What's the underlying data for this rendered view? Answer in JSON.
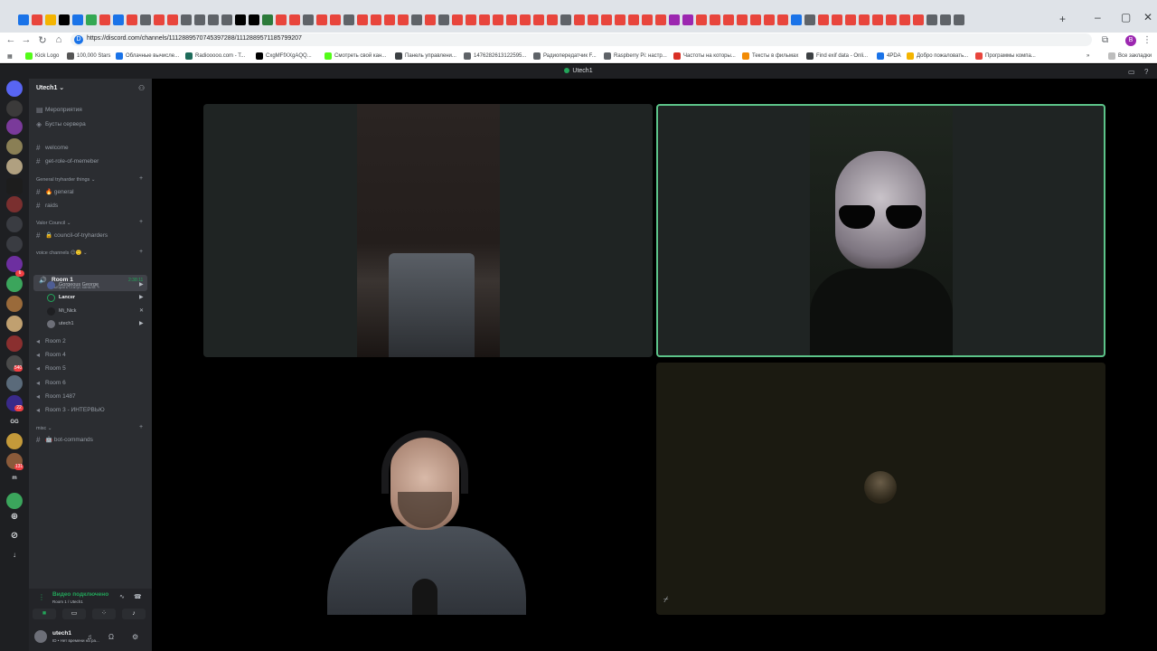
{
  "browser": {
    "url": "https://discord.com/channels/1112889570745397288/1112889571185799207",
    "new_tab": "+",
    "bookmarks": [
      {
        "label": "Kick Logo",
        "color": "#53fc18"
      },
      {
        "label": "100,000 Stars",
        "color": "#555555"
      },
      {
        "label": "Облачные вычисле...",
        "color": "#1a73e8"
      },
      {
        "label": "Radiooooo.com - T...",
        "color": "#1d6b5a"
      },
      {
        "label": "CxgMFfXXgAQQ...",
        "color": "#000000"
      },
      {
        "label": "Смотреть свой кан...",
        "color": "#53fc18"
      },
      {
        "label": "Панель управлени...",
        "color": "#3c4043"
      },
      {
        "label": "1476282613122595...",
        "color": "#5f6368"
      },
      {
        "label": "Радиопередатчик F...",
        "color": "#5f6368"
      },
      {
        "label": "Raspberry Pi: настр...",
        "color": "#5f6368"
      },
      {
        "label": "Частоты на которы...",
        "color": "#d93025"
      },
      {
        "label": "Тексты в фильмах",
        "color": "#f28b05"
      },
      {
        "label": "Find exif data - Onli...",
        "color": "#3c4043"
      },
      {
        "label": "4PDA",
        "color": "#1a73e8"
      },
      {
        "label": "Добро пожаловать...",
        "color": "#f4b400"
      },
      {
        "label": "Программы компа...",
        "color": "#e8453c"
      }
    ],
    "all_bookmarks": "Все закладки"
  },
  "titlebar": {
    "title": "Utech1"
  },
  "servers": {
    "labels": [
      "GG",
      "m"
    ],
    "badges": [
      "6",
      "540",
      "22",
      "131"
    ]
  },
  "guild": {
    "name": "Utech1 ⌄",
    "top_items": [
      "Мероприятия",
      "Бусты сервера"
    ],
    "channels_a": [
      "welcome",
      "get-role-of-memeber"
    ],
    "category_b": "General tryharder things ⌄",
    "channels_b": [
      "🔥 general",
      "raids"
    ],
    "category_c": "Valor Council ⌄",
    "channels_c": [
      "🔒 council-of-tryharders"
    ],
    "category_d": "voice channels 😊🙂 ⌄",
    "active_room": {
      "name": "Room 1",
      "status": "Выбрать статус канала ✎",
      "time": "2:38:11"
    },
    "members": [
      "Gorgeous George",
      "Lancer",
      "Mi_Nick",
      "utech1"
    ],
    "rooms": [
      "Room 2",
      "Room 4",
      "Room 5",
      "Room 6",
      "Room 1487",
      "Room 3 - ИНТЕРВЬЮ"
    ],
    "category_e": "misc ⌄",
    "channels_e": [
      "🤖 bot-commands"
    ]
  },
  "voice_panel": {
    "status": "Видео подключено",
    "sub": "Room 1 / Utech1"
  },
  "user": {
    "name": "utech1",
    "status": "ID • Нет времени на ра..."
  }
}
